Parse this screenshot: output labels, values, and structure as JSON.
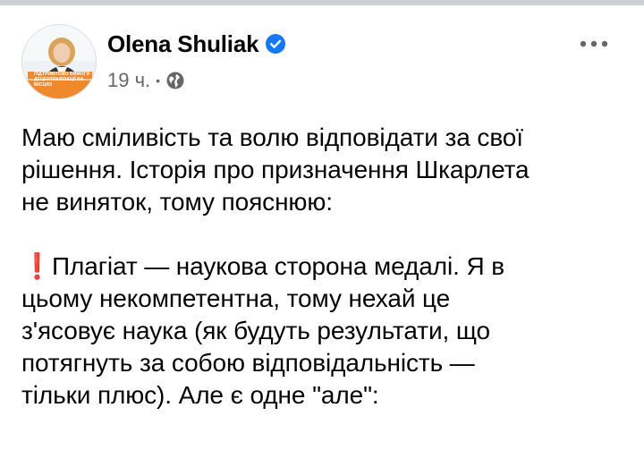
{
  "post": {
    "author": "Olena Shuliak",
    "verified": true,
    "time": "19 ч.",
    "separator": "•",
    "audience_icon": "globe-icon",
    "more_icon": "more-options-icon",
    "avatar_caption": "ПІДТРИМУЄМО ВИМОГИ ДЕЦЕНТРАЛІЗАЦІЇ НА МІСЦЯХ",
    "paragraph1": [
      "Маю сміливість та волю відповідати за свої",
      "рішення. Історія про призначення Шкарлета",
      "не виняток, тому пояснюю:"
    ],
    "paragraph2_marker": "❗",
    "paragraph2": [
      "Плагіат — наукова сторона медалі. Я в",
      "цьому некомпетентна, тому нехай це",
      "з'ясовує наука (як будуть  результати, що",
      "потягнуть за собою відповідальність —",
      "тільки плюс). Але є одне \"але\":"
    ]
  },
  "colors": {
    "text": "#050505",
    "secondary": "#65676b",
    "verified_blue": "#1877f2",
    "accent_red": "#e8382b",
    "avatar_orange": "#f0892b"
  }
}
